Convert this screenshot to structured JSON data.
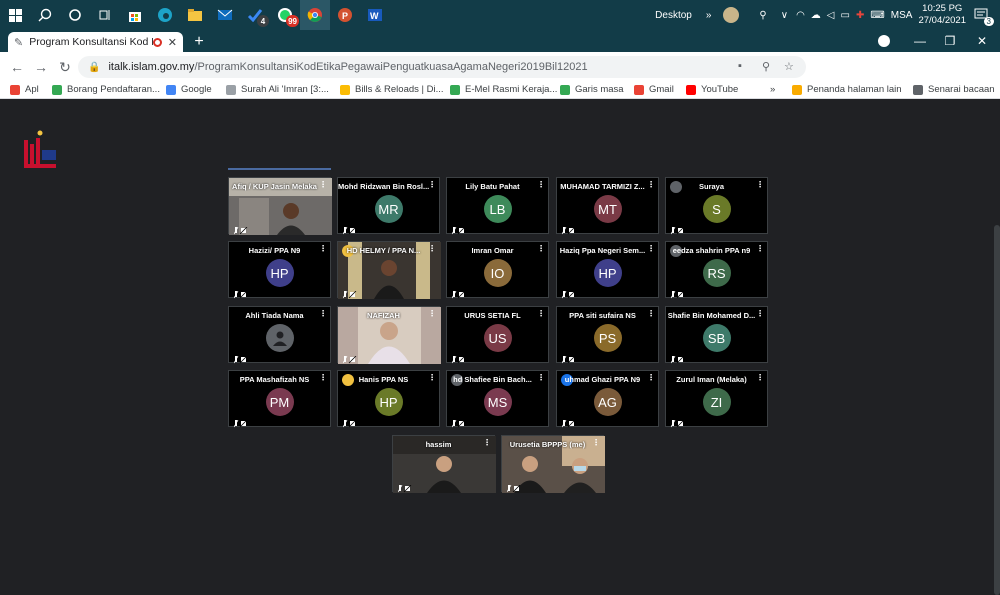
{
  "taskbar": {
    "apps": [
      {
        "name": "windows-start",
        "badge": ""
      },
      {
        "name": "search",
        "badge": ""
      },
      {
        "name": "cortana",
        "badge": ""
      },
      {
        "name": "task-view",
        "badge": ""
      },
      {
        "name": "store",
        "badge": ""
      },
      {
        "name": "edge",
        "badge": ""
      },
      {
        "name": "file-explorer",
        "badge": ""
      },
      {
        "name": "mail",
        "badge": ""
      },
      {
        "name": "todo",
        "badge": "4"
      },
      {
        "name": "whatsapp",
        "badge": "99"
      },
      {
        "name": "chrome",
        "badge": ""
      },
      {
        "name": "powerpoint",
        "badge": ""
      },
      {
        "name": "word",
        "badge": ""
      }
    ],
    "desktop_label": "Desktop",
    "lang": "MSA",
    "time": "10:25 PG",
    "date": "27/04/2021",
    "notif_count": "3"
  },
  "tab": {
    "title": "Program Konsultansi Kod Etika"
  },
  "address": {
    "host": "italk.islam.gov.my",
    "path": "/ProgramKonsultansiKodEtikaPegawaiPenguatkuasaAgamaNegeri2019Bil12021"
  },
  "ext_badge": "9287",
  "bookmarks": [
    {
      "label": "Apl",
      "color": "#ea4335"
    },
    {
      "label": "Borang Pendaftaran...",
      "color": "#34a853"
    },
    {
      "label": "Google",
      "color": "#4285f4"
    },
    {
      "label": "Surah Ali 'Imran [3:...",
      "color": "#9aa0a6"
    },
    {
      "label": "Bills & Reloads | Di...",
      "color": "#fbbc04"
    },
    {
      "label": "E-Mel Rasmi Keraja...",
      "color": "#34a853"
    },
    {
      "label": "Garis masa",
      "color": "#34a853"
    },
    {
      "label": "Gmail",
      "color": "#ea4335"
    },
    {
      "label": "YouTube",
      "color": "#ff0000"
    },
    {
      "label": "»",
      "color": ""
    },
    {
      "label": "Penanda halaman lain",
      "color": "#f9ab00"
    },
    {
      "label": "Senarai bacaan",
      "color": "#5f6368"
    }
  ],
  "tiles": [
    {
      "name": "Afiq / KUP Jasin Melaka",
      "initials": "",
      "color": "#000",
      "video": true,
      "vidstyle": "room1"
    },
    {
      "name": "Mohd Ridzwan Bin Rosl...",
      "initials": "MR",
      "color": "#3e7a6a",
      "video": false
    },
    {
      "name": "Lily Batu Pahat",
      "initials": "LB",
      "color": "#3e8a5a",
      "video": false
    },
    {
      "name": "MUHAMAD TARMIZI Z...",
      "initials": "MT",
      "color": "#7a3a46",
      "video": false
    },
    {
      "name": "Suraya",
      "initials": "S",
      "color": "#6a7a28",
      "video": false,
      "mini": "#5f6368"
    },
    {
      "name": "Hazizi/ PPA N9",
      "initials": "HP",
      "color": "#3f3f8a",
      "video": false
    },
    {
      "name": "HD HELMY / PPA N...",
      "initials": "",
      "color": "#000",
      "video": true,
      "vidstyle": "room2",
      "mini": "#f0c040"
    },
    {
      "name": "Imran Omar",
      "initials": "IO",
      "color": "#8a6a3a",
      "video": false
    },
    {
      "name": "Haziq Ppa Negeri Sem...",
      "initials": "HP",
      "color": "#3f3f8a",
      "video": false
    },
    {
      "name": "eedza shahrin PPA n9",
      "initials": "RS",
      "color": "#3e6a4a",
      "video": false,
      "mini": "#5f6368"
    },
    {
      "name": "Ahli Tiada Nama",
      "initials": "",
      "color": "#5f6368",
      "video": false,
      "anon": true
    },
    {
      "name": "NAFIZAH",
      "initials": "",
      "color": "#000",
      "video": true,
      "vidstyle": "room3"
    },
    {
      "name": "URUS SETIA FL",
      "initials": "US",
      "color": "#7a3a46",
      "video": false
    },
    {
      "name": "PPA siti sufaira NS",
      "initials": "PS",
      "color": "#8a6a2a",
      "video": false
    },
    {
      "name": "Shafie Bin Mohamed D...",
      "initials": "SB",
      "color": "#3e7a6a",
      "video": false
    },
    {
      "name": "PPA Mashafizah NS",
      "initials": "PM",
      "color": "#7a3a50",
      "video": false
    },
    {
      "name": "Hanis PPA NS",
      "initials": "HP",
      "color": "#6a7a28",
      "video": false,
      "mini": "#f0c040"
    },
    {
      "name": "hd Shafiee Bin Bach...",
      "initials": "MS",
      "color": "#7a3a50",
      "video": false,
      "mini": "#5f6368"
    },
    {
      "name": "uhmad Ghazi PPA N9",
      "initials": "AG",
      "color": "#7a5a3a",
      "video": false,
      "mini": "#1a73e8"
    },
    {
      "name": "Zurul Iman (Melaka)",
      "initials": "ZI",
      "color": "#3e6a4a",
      "video": false
    },
    {
      "name": "hassim",
      "initials": "",
      "color": "#000",
      "video": true,
      "vidstyle": "room4"
    },
    {
      "name": "Urusetia BPPPS (me)",
      "initials": "",
      "color": "#000",
      "video": true,
      "vidstyle": "room5"
    }
  ]
}
